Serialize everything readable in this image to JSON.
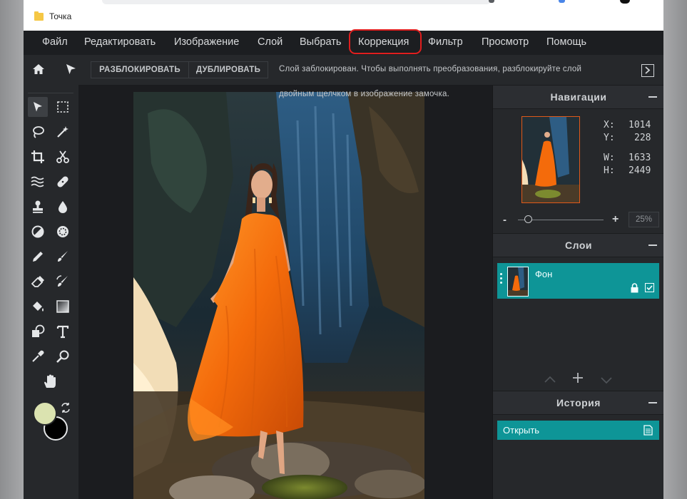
{
  "browser": {
    "bookmark_label": "Точка"
  },
  "menu": {
    "items": [
      {
        "label": "Файл"
      },
      {
        "label": "Редактировать"
      },
      {
        "label": "Изображение"
      },
      {
        "label": "Слой"
      },
      {
        "label": "Выбрать"
      },
      {
        "label": "Коррекция"
      },
      {
        "label": "Фильтр"
      },
      {
        "label": "Просмотр"
      },
      {
        "label": "Помощь"
      }
    ],
    "highlight_color": "#e01e1e"
  },
  "toolbar": {
    "unlock_label": "РАЗБЛОКИРОВАТЬ",
    "duplicate_label": "ДУБЛИРОВАТЬ",
    "message_line1": "Слой заблокирован. Чтобы выполнять преобразования, разблокируйте слой",
    "message_line2": "двойным щелчком в изображение замочка."
  },
  "tools": [
    "move-tool",
    "marquee-tool",
    "lasso-tool",
    "magic-wand-tool",
    "crop-tool",
    "scissors-tool",
    "liquify-tool",
    "healing-tool",
    "stamp-tool",
    "blur-tool",
    "dodge-tool",
    "sponge-tool",
    "pencil-tool",
    "brush-tool",
    "eraser-tool",
    "replace-color-tool",
    "fill-tool",
    "gradient-tool",
    "shape-tool",
    "text-tool",
    "eyedropper-tool",
    "zoom-tool",
    "hand-tool"
  ],
  "colors": {
    "foreground": "#dbe3b0",
    "background": "#000000",
    "accent": "#0e9597"
  },
  "navigator": {
    "title": "Навигации",
    "x_label": "X:",
    "x": "1014",
    "y_label": "Y:",
    "y": "228",
    "w_label": "W:",
    "w": "1633",
    "h_label": "H:",
    "h": "2449",
    "zoom_minus": "-",
    "zoom_plus": "+",
    "zoom_value": "25%"
  },
  "layers": {
    "title": "Слои",
    "items": [
      {
        "name": "Фон"
      }
    ]
  },
  "history": {
    "title": "История",
    "items": [
      {
        "label": "Открыть"
      }
    ]
  }
}
